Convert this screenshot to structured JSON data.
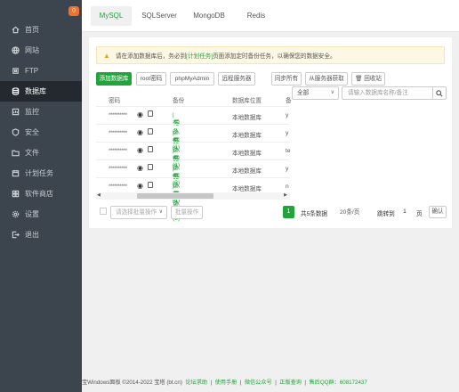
{
  "sidebar": {
    "badge": "0",
    "items": [
      {
        "label": "首页",
        "icon": "home-icon"
      },
      {
        "label": "网站",
        "icon": "globe-icon"
      },
      {
        "label": "FTP",
        "icon": "ftp-icon"
      },
      {
        "label": "数据库",
        "icon": "database-icon",
        "active": true
      },
      {
        "label": "监控",
        "icon": "monitor-icon"
      },
      {
        "label": "安全",
        "icon": "shield-icon"
      },
      {
        "label": "文件",
        "icon": "folder-icon"
      },
      {
        "label": "计划任务",
        "icon": "calendar-icon"
      },
      {
        "label": "软件商店",
        "icon": "grid-icon"
      },
      {
        "label": "设置",
        "icon": "gear-icon"
      },
      {
        "label": "退出",
        "icon": "logout-icon"
      }
    ]
  },
  "tabs": [
    "MySQL",
    "SQLServer",
    "MongoDB",
    "Redis"
  ],
  "alert": {
    "prefix": "请在添加数据库后，务必到",
    "link": "[计划任务]",
    "suffix": "页面添加定时备份任务，以确保您的数据安全。"
  },
  "toolbar": {
    "add_db": "添加数据库",
    "root_pw": "root密码",
    "phpmyadmin": "phpMyAdmin",
    "remote": "远程服务器",
    "sync_all": "同步所有",
    "from_server": "从服务器获取",
    "recycle": "回收站",
    "filter": "全部",
    "search_placeholder": "请输入数据库名称/备注"
  },
  "table": {
    "headers": [
      "密码",
      "备份",
      "数据库位置",
      "备"
    ],
    "rows": [
      {
        "password": "**********",
        "backup": "有备份(1)",
        "import": "导入",
        "location": "本地数据库",
        "extra": "y"
      },
      {
        "password": "**********",
        "backup": "有备份(1)",
        "import": "导入",
        "location": "本地数据库",
        "extra": "y"
      },
      {
        "password": "**********",
        "backup": "有备份(3)",
        "import": "导入",
        "location": "本地数据库",
        "extra": "te"
      },
      {
        "password": "**********",
        "backup": "有备份(1)",
        "import": "导入",
        "location": "本地数据库",
        "extra": "y"
      },
      {
        "password": "**********",
        "backup": "有备份(3)",
        "import": "导入",
        "location": "本地数据库",
        "extra": "n"
      }
    ]
  },
  "batch": {
    "select_placeholder": "请选择批量操作",
    "batch_button": "批量操作"
  },
  "pagination": {
    "current": "1",
    "total": "共5条数据",
    "per_page": "20条/页",
    "jump_label": "跳转到",
    "page_value": "1",
    "page_unit": "页",
    "confirm": "确认"
  },
  "footer": {
    "copyright": "宝Windows面板 ©2014-2022 宝塔 (bt.cn)",
    "links": [
      "论坛求助",
      "使用手册",
      "微信公众号",
      "正版查询",
      "售后QQ群：608172437"
    ]
  }
}
